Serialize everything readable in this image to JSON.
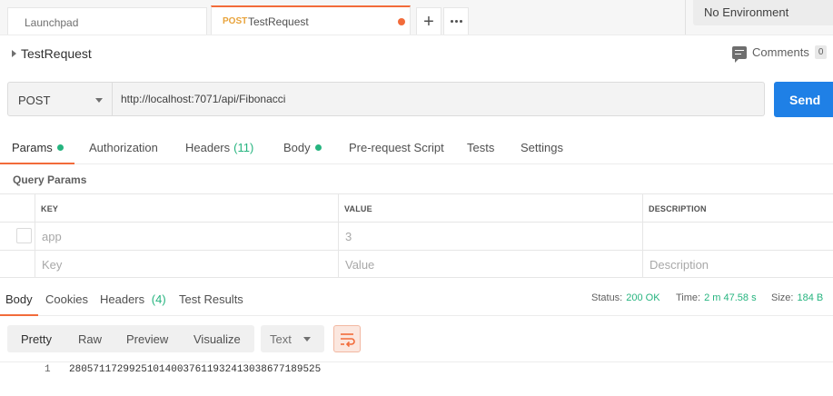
{
  "tabs": {
    "launchpad_label": "Launchpad",
    "active_method": "POST",
    "active_name": "TestRequest"
  },
  "environment": {
    "selected": "No Environment"
  },
  "request": {
    "title": "TestRequest",
    "comments_label": "Comments",
    "comments_count": "0",
    "method": "POST",
    "url": "http://localhost:7071/api/Fibonacci",
    "send_label": "Send"
  },
  "request_tabs": {
    "params": "Params",
    "authorization": "Authorization",
    "headers": "Headers",
    "headers_count": "(11)",
    "body": "Body",
    "prerequest": "Pre-request Script",
    "tests": "Tests",
    "settings": "Settings"
  },
  "query_params": {
    "title": "Query Params",
    "columns": {
      "key": "KEY",
      "value": "VALUE",
      "description": "DESCRIPTION"
    },
    "rows": [
      {
        "key": "app",
        "value": "3",
        "description": ""
      }
    ],
    "placeholders": {
      "key": "Key",
      "value": "Value",
      "description": "Description"
    }
  },
  "response_tabs": {
    "body": "Body",
    "cookies": "Cookies",
    "headers": "Headers",
    "headers_count": "(4)",
    "test_results": "Test Results"
  },
  "status": {
    "status_label": "Status:",
    "status_value": "200 OK",
    "time_label": "Time:",
    "time_value": "2 m 47.58 s",
    "size_label": "Size:",
    "size_value": "184 B"
  },
  "format": {
    "pretty": "Pretty",
    "raw": "Raw",
    "preview": "Preview",
    "visualize": "Visualize",
    "type": "Text"
  },
  "response_body": {
    "line_number": "1",
    "content": "280571172992510140037611932413038677189525"
  },
  "colors": {
    "accent": "#f26b3a",
    "send_button": "#1f80e6",
    "success": "#26b47f",
    "method_tab": "#e8a33b"
  }
}
